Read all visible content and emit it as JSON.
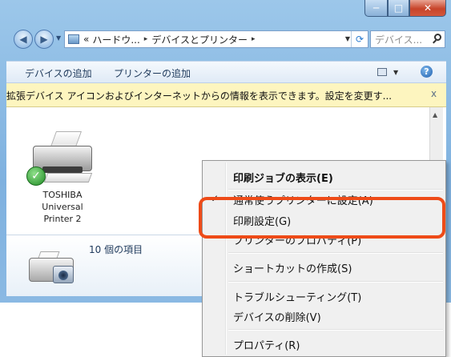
{
  "window": {
    "nav": {
      "back_icon": "back-arrow-icon",
      "forward_icon": "forward-arrow-icon"
    },
    "address": {
      "prefix": "«",
      "segments": [
        "ハードウ...",
        "デバイスとプリンター"
      ],
      "separator": "▸"
    },
    "search": {
      "placeholder": "デバイス..."
    },
    "controls": {
      "minimize": "─",
      "maximize": "□",
      "close": "✕"
    }
  },
  "command_bar": {
    "add_device": "デバイスの追加",
    "add_printer": "プリンターの追加",
    "help": "?"
  },
  "info_bar": {
    "text": "拡張デバイス アイコンおよびインターネットからの情報を表示できます。設定を変更す...",
    "close": "x"
  },
  "devices": [
    {
      "name_lines": [
        "TOSHIBA",
        "Universal",
        "Printer 2"
      ],
      "is_default": true
    }
  ],
  "details_pane": {
    "item_count": "10 個の項目"
  },
  "context_menu": {
    "items": [
      {
        "label": "印刷ジョブの表示(E)",
        "bold": true
      },
      {
        "label": "通常使うプリンターに設定(A)",
        "checked": true
      },
      {
        "label": "印刷設定(G)",
        "highlighted": true
      },
      {
        "label": "プリンターのプロパティ(P)"
      },
      {
        "label": "ショートカットの作成(S)"
      },
      {
        "label": "トラブルシューティング(T)"
      },
      {
        "label": "デバイスの削除(V)"
      },
      {
        "label": "プロパティ(R)"
      }
    ],
    "check_mark": "✓"
  },
  "colors": {
    "highlight_border": "#ee4b18",
    "info_bar_bg": "#fdf5bf",
    "title_bar": "#8ab9e3"
  }
}
